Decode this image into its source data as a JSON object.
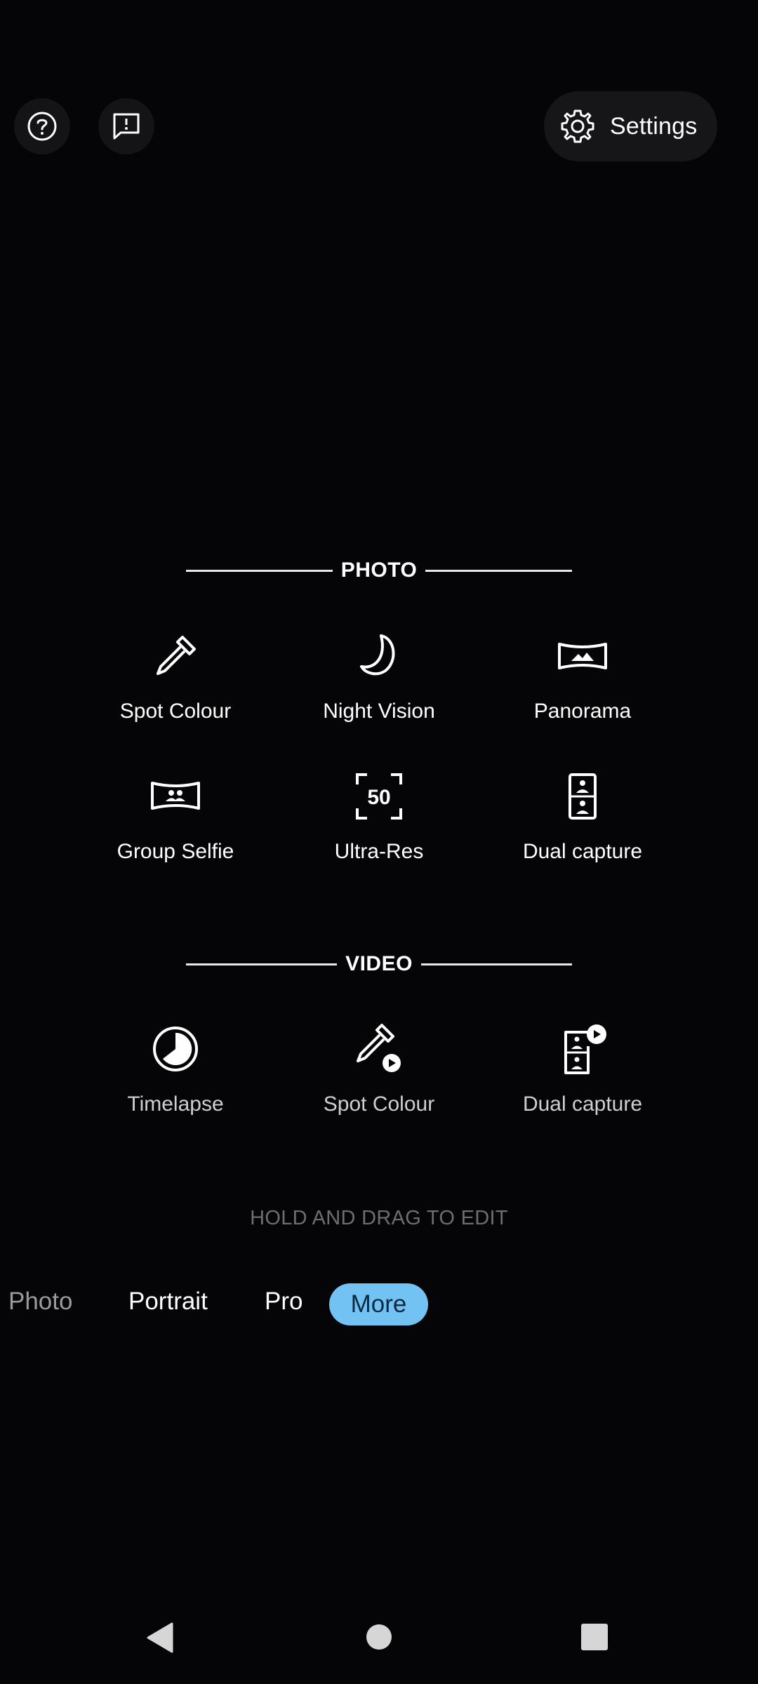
{
  "header": {
    "help_icon": "help-circle-icon",
    "feedback_icon": "feedback-icon",
    "settings_label": "Settings",
    "settings_icon": "gear-icon"
  },
  "photo_section": {
    "title": "PHOTO",
    "modes": [
      {
        "label": "Spot Colour",
        "icon": "eyedropper-icon"
      },
      {
        "label": "Night Vision",
        "icon": "moon-icon"
      },
      {
        "label": "Panorama",
        "icon": "panorama-icon"
      },
      {
        "label": "Group Selfie",
        "icon": "group-selfie-icon"
      },
      {
        "label": "Ultra-Res",
        "icon": "ultra-res-50-icon"
      },
      {
        "label": "Dual capture",
        "icon": "dual-capture-icon"
      }
    ]
  },
  "video_section": {
    "title": "VIDEO",
    "modes": [
      {
        "label": "Timelapse",
        "icon": "timelapse-icon"
      },
      {
        "label": "Spot Colour",
        "icon": "eyedropper-video-icon"
      },
      {
        "label": "Dual capture",
        "icon": "dual-capture-video-icon"
      }
    ]
  },
  "hint": "HOLD AND DRAG TO EDIT",
  "carousel": {
    "items": [
      "Photo",
      "Portrait",
      "Pro",
      "More"
    ],
    "selected": "More",
    "accent": "#72c3f3"
  },
  "navbar": {
    "back_icon": "back-triangle-icon",
    "home_icon": "home-circle-icon",
    "recents_icon": "recents-square-icon"
  }
}
